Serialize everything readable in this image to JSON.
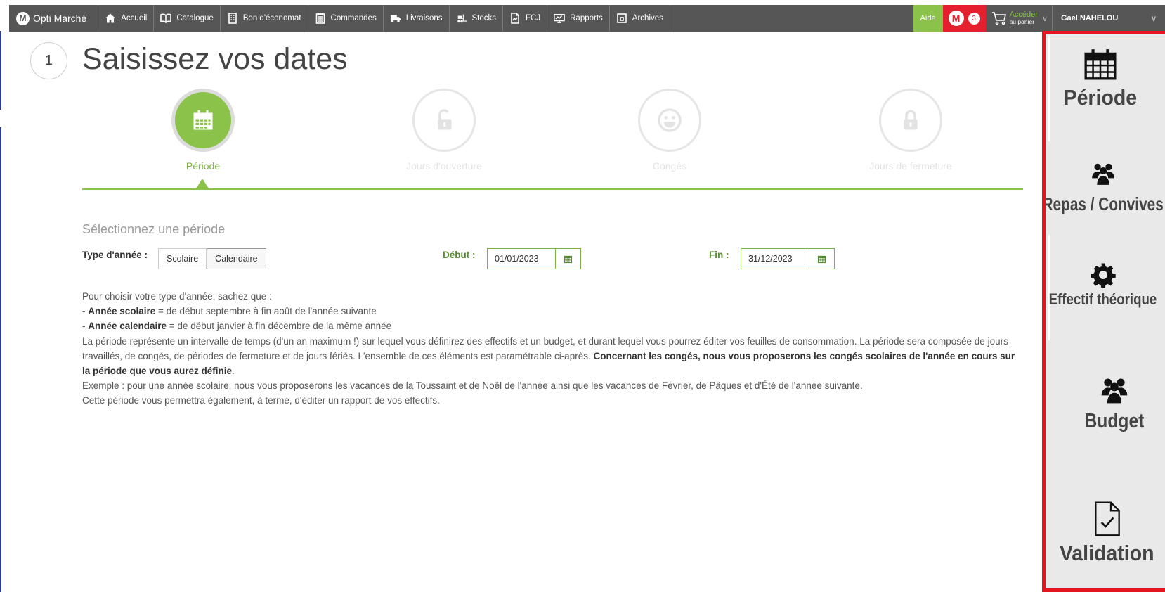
{
  "topbar": {
    "logo_text": "Opti Marché",
    "nav": [
      {
        "label": "Accueil",
        "icon": "home-icon"
      },
      {
        "label": "Catalogue",
        "icon": "book-icon"
      },
      {
        "label": "Bon d'économat",
        "icon": "building-icon"
      },
      {
        "label": "Commandes",
        "icon": "clipboard-icon"
      },
      {
        "label": "Livraisons",
        "icon": "truck-icon"
      },
      {
        "label": "Stocks",
        "icon": "forklift-icon"
      },
      {
        "label": "FCJ",
        "icon": "document-icon"
      },
      {
        "label": "Rapports",
        "icon": "monitor-chart-icon"
      },
      {
        "label": "Archives",
        "icon": "archive-box-icon"
      }
    ],
    "help_label": "Aide",
    "notification_count": "3",
    "cart_line1": "Accéder",
    "cart_line2": "au panier",
    "user_name": "Gael NAHELOU",
    "colors": {
      "bar": "#565656",
      "help": "#8bc34a",
      "notif": "#e5202e"
    }
  },
  "step": {
    "number": "1",
    "title": "Saisissez vos dates"
  },
  "wizard": {
    "steps": [
      {
        "label": "Période",
        "icon": "calendar-icon",
        "active": true
      },
      {
        "label": "Jours d'ouverture",
        "icon": "unlock-icon",
        "active": false
      },
      {
        "label": "Congés",
        "icon": "smiley-icon",
        "active": false
      },
      {
        "label": "Jours de fermeture",
        "icon": "lock-icon",
        "active": false
      }
    ],
    "accent": "#8bc34a"
  },
  "form": {
    "section_title": "Sélectionnez une période",
    "type_label": "Type d'année :",
    "type_options": [
      "Scolaire",
      "Calendaire"
    ],
    "type_selected": "Calendaire",
    "start_label": "Début :",
    "start_value": "01/01/2023",
    "end_label": "Fin :",
    "end_value": "31/12/2023"
  },
  "info": {
    "intro": "Pour choisir votre type d'année, sachez que :",
    "scolaire_prefix": "- ",
    "scolaire_term": "Année scolaire",
    "scolaire_desc": " = de début septembre à fin août de l'année suivante",
    "calendaire_prefix": "- ",
    "calendaire_term": "Année calendaire",
    "calendaire_desc": " = de début janvier à fin décembre de la même année",
    "period_text": "La période représente un intervalle de temps (d'un an maximum !) sur lequel vous définirez des effectifs et un budget, et durant lequel vous pourrez éditer vos feuilles de consommation. La période sera composée de jours travaillés, de congés, de périodes de fermeture et de jours fériés. L'ensemble de ces éléments est paramétrable ci-après. ",
    "period_bold": "Concernant les congés, nous vous proposerons les congés scolaires de l'année en cours sur la période que vous aurez définie",
    "period_end": ".",
    "example": "Exemple : pour une année scolaire, nous vous proposerons les vacances de la Toussaint et de Noël de l'année ainsi que les vacances de Février, de Pâques et d'Été de l'année suivante.",
    "report": "Cette période vous permettra également, à terme, d'éditer un rapport de vos effectifs."
  },
  "side_panel": {
    "items": [
      {
        "label": "Période",
        "icon": "calendar-icon"
      },
      {
        "label": "Repas / Convives",
        "icon": "users-icon"
      },
      {
        "label": "Effectif théorique",
        "icon": "gear-icon"
      },
      {
        "label": "Budget",
        "icon": "users-icon"
      },
      {
        "label": "Validation",
        "icon": "document-check-icon"
      }
    ],
    "border_color": "#e4151f"
  }
}
